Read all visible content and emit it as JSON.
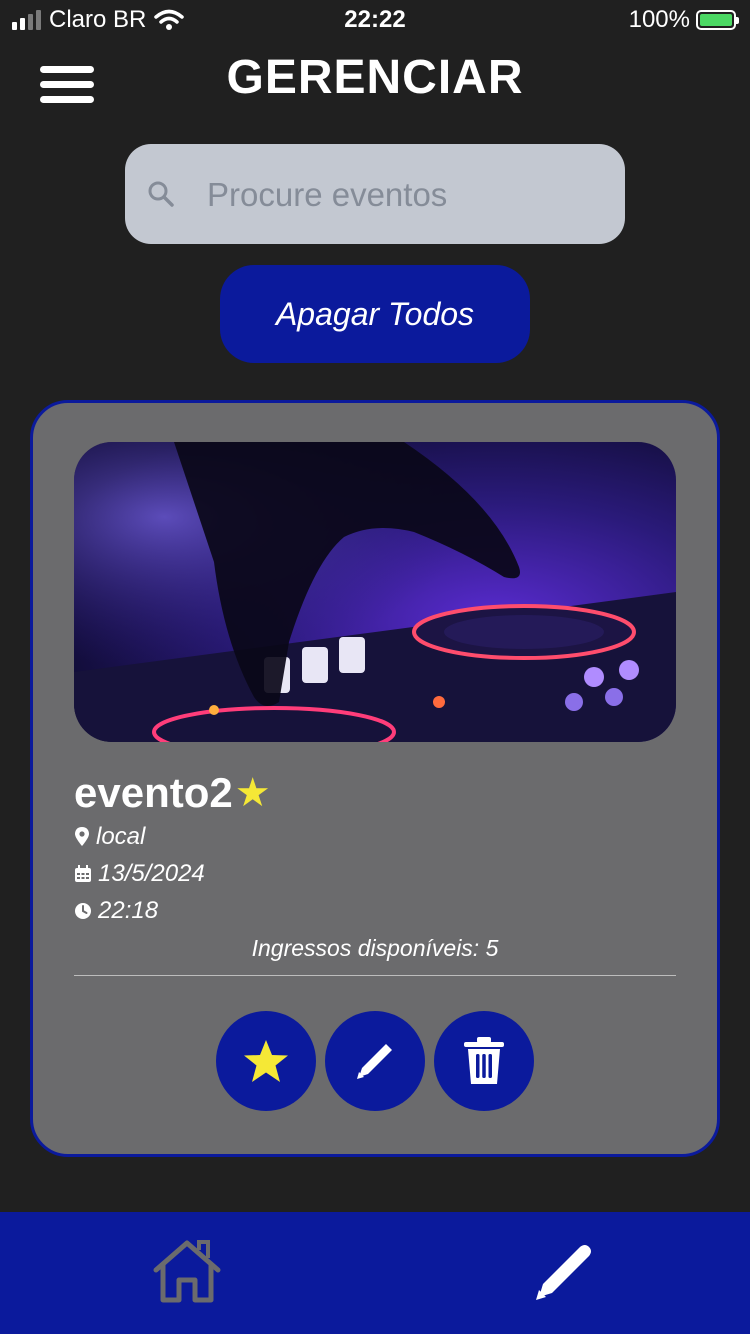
{
  "status_bar": {
    "carrier": "Claro BR",
    "time": "22:22",
    "battery": "100%"
  },
  "header": {
    "title": "GERENCIAR",
    "menu_icon": "hamburger-menu-icon"
  },
  "search": {
    "placeholder": "Procure eventos",
    "value": "",
    "icon": "search-icon"
  },
  "delete_all_label": "Apagar Todos",
  "event_card": {
    "name": "evento2",
    "favorite_star": "★",
    "location": "local",
    "date": "13/5/2024",
    "time": "22:18",
    "tickets_available": "Ingressos disponíveis: 5",
    "image_description_icon": "event-image",
    "actions": [
      "star-icon",
      "pencil-icon",
      "trash-icon"
    ]
  },
  "colors": {
    "background": "#202020",
    "accent_blue": "#0b1a9c",
    "card_gray": "#6b6b6d",
    "search_bg": "#c3c8d1",
    "star_yellow": "#f5e836"
  },
  "bottom_nav": {
    "items": [
      "home-icon",
      "pencil-icon"
    ]
  }
}
